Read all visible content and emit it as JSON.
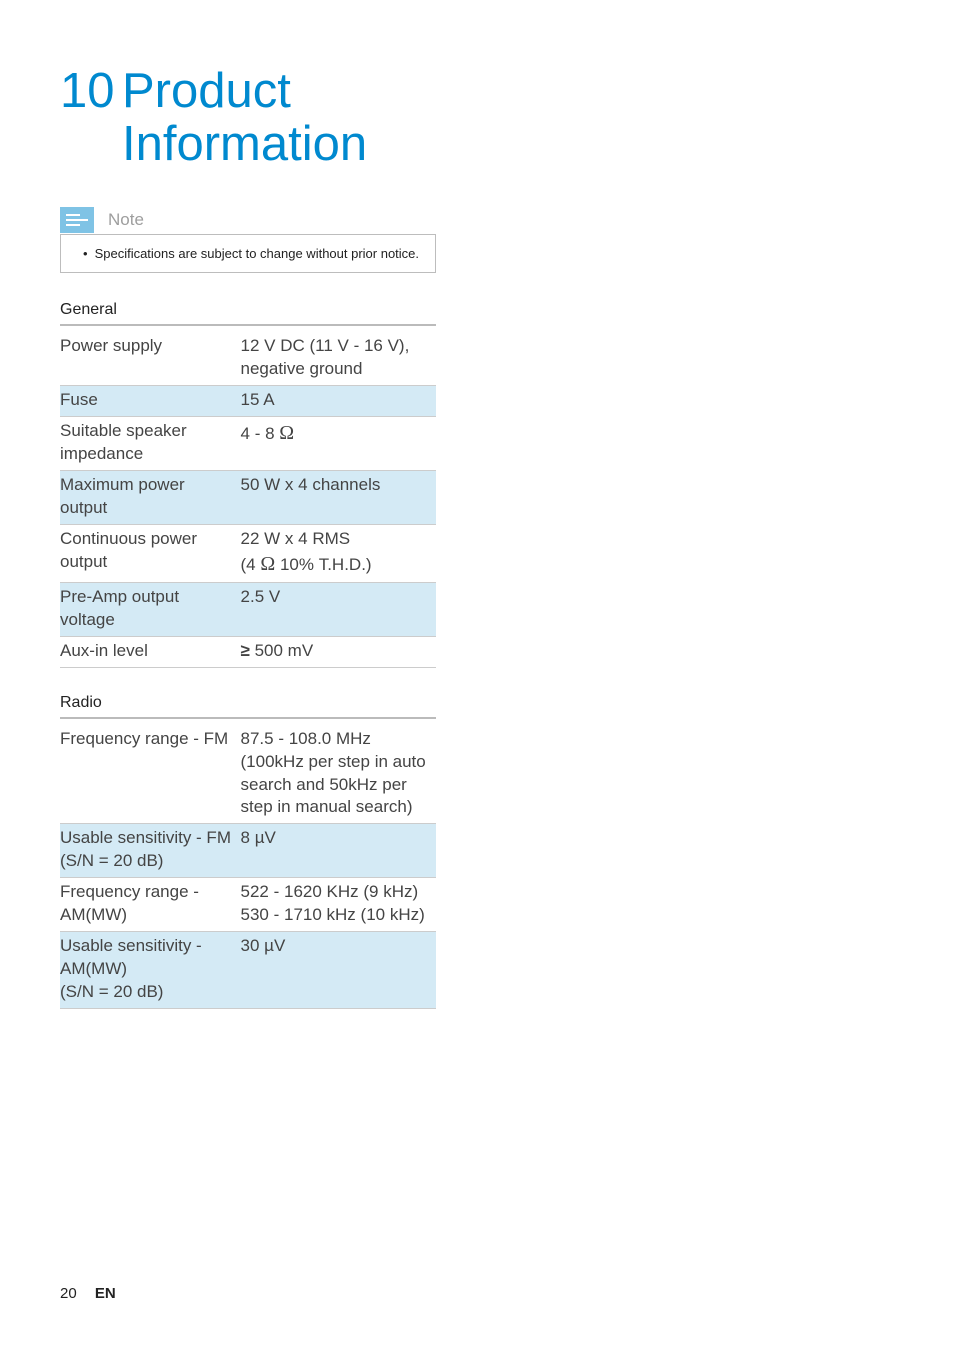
{
  "chapter": {
    "number": "10",
    "title_line1": "Product",
    "title_line2": "Information"
  },
  "note": {
    "label": "Note",
    "bullet": "Specifications are subject to change without prior notice."
  },
  "sections": {
    "general": {
      "heading": "General",
      "rows": [
        {
          "label": "Power supply",
          "value": "12 V DC (11 V - 16 V), negative ground",
          "alt": false
        },
        {
          "label": "Fuse",
          "value": "15 A",
          "alt": true
        },
        {
          "label": "Suitable speaker impedance",
          "value_prefix": "4 - 8 ",
          "value_omega": "Ω",
          "value_suffix": "",
          "alt": false
        },
        {
          "label": "Maximum power output",
          "value": "50 W x 4 channels",
          "alt": true
        },
        {
          "label": "Continuous power output",
          "value_line1": "22 W x 4 RMS",
          "value_line2_prefix": "(4 ",
          "value_line2_omega": "Ω",
          "value_line2_suffix": " 10% T.H.D.)",
          "alt": false
        },
        {
          "label": "Pre-Amp output voltage",
          "value": "2.5 V",
          "alt": true
        },
        {
          "label": "Aux-in level",
          "value_geq": "≥",
          "value_after": " 500 mV",
          "alt": false
        }
      ]
    },
    "radio": {
      "heading": "Radio",
      "rows": [
        {
          "label": "Frequency range - FM",
          "value": "87.5 - 108.0 MHz (100kHz per step in auto search and 50kHz per step in manual search)",
          "alt": false
        },
        {
          "label": "Usable sensitivity - FM (S/N = 20 dB)",
          "value": "8 µV",
          "alt": true
        },
        {
          "label": "Frequency range - AM(MW)",
          "value_line1": "522 - 1620 KHz (9 kHz)",
          "value_line2": "530 - 1710 kHz (10 kHz)",
          "alt": false
        },
        {
          "label": "Usable sensitivity - AM(MW)\n (S/N = 20 dB)",
          "value": "30 µV",
          "alt": true
        }
      ]
    }
  },
  "footer": {
    "page": "20",
    "lang": "EN"
  }
}
